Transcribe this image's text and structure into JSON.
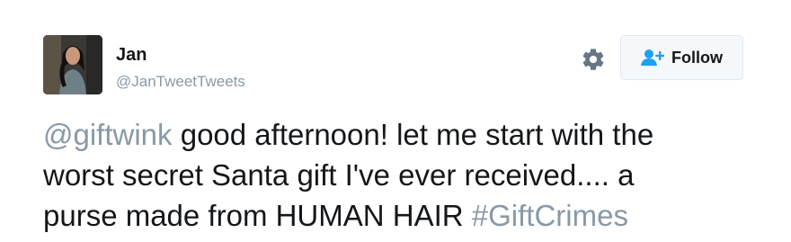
{
  "user": {
    "name": "Jan",
    "handle": "@JanTweetTweets"
  },
  "actions": {
    "settings_icon": "gear-icon",
    "follow_icon": "user-plus-icon",
    "follow_label": "Follow"
  },
  "tweet": {
    "mention": "@giftwink",
    "line1_text": " good afternoon! let me start with the",
    "line2_text": "worst secret Santa gift I've ever received.... a",
    "line3_text": "purse made from HUMAN HAIR ",
    "hashtag": "#GiftCrimes"
  },
  "colors": {
    "text": "#14171a",
    "muted": "#8899a6",
    "link": "#8899a6",
    "follow_accent": "#1da1f2",
    "button_bg": "#f5f8fa"
  }
}
